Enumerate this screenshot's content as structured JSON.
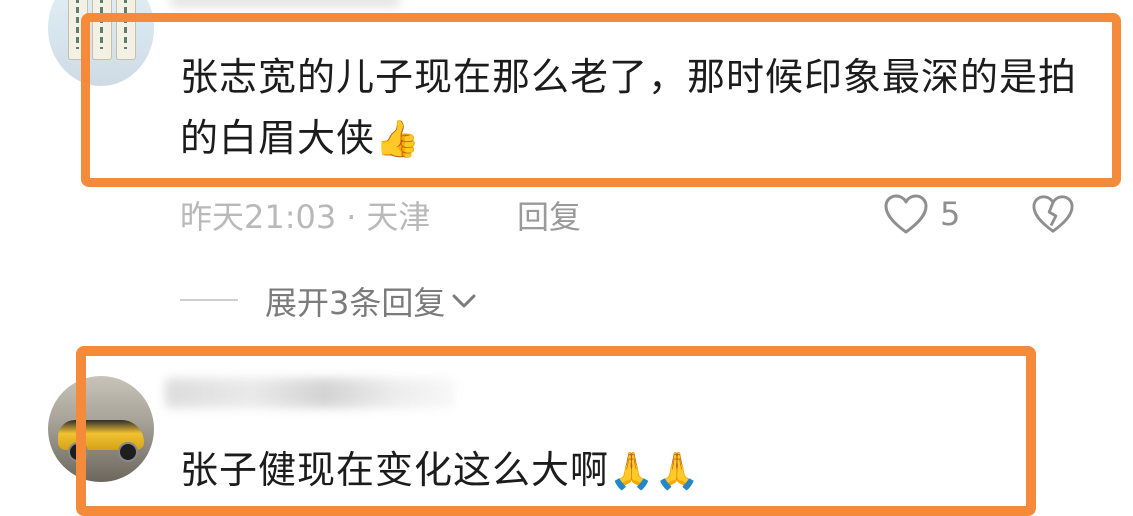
{
  "comments": [
    {
      "text": "张志宽的儿子现在那么老了，那时候印象最深的是拍的白眉大侠",
      "emoji": "👍",
      "time": "昨天21:03",
      "separator": "·",
      "location": "天津",
      "reply_label": "回复",
      "like_count": "5",
      "expand_label": "展开3条回复"
    },
    {
      "text": "张子健现在变化这么大啊",
      "emoji": "🙏🙏"
    }
  ],
  "icons": {
    "like": "heart-outline-icon",
    "dislike": "broken-heart-icon",
    "expand": "chevron-down-icon"
  },
  "colors": {
    "highlight": "#f58a3a",
    "meta": "#b9b9b9"
  }
}
